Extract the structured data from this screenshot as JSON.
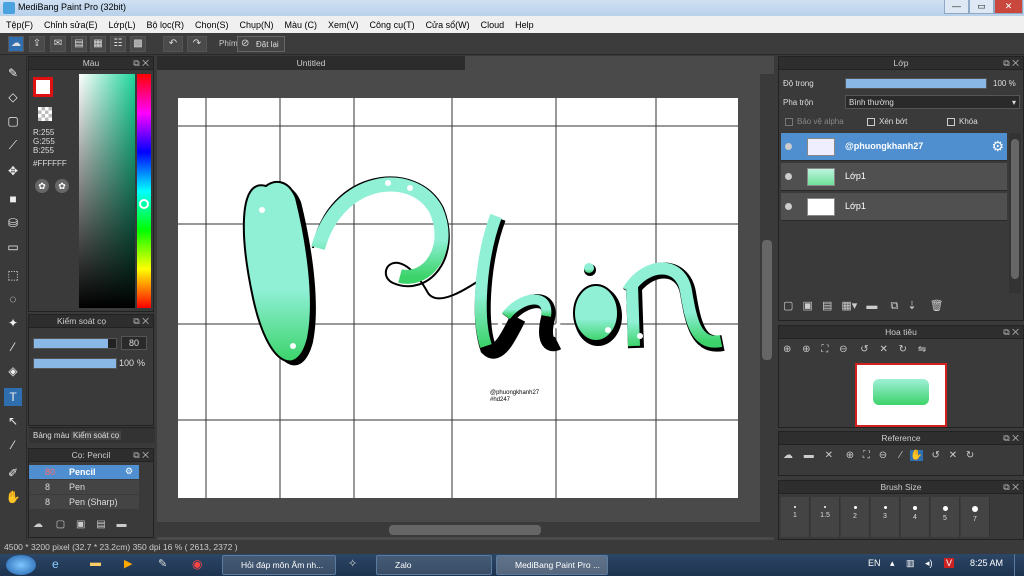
{
  "app": {
    "window_title": "MediBang Paint Pro (32bit)",
    "minimize": "—",
    "maximize": "▭",
    "close": "✕"
  },
  "menu": [
    "Tệp(F)",
    "Chỉnh sửa(E)",
    "Lớp(L)",
    "Bộ lọc(R)",
    "Chọn(S)",
    "Chụp(N)",
    "Màu (C)",
    "Xem(V)",
    "Công cụ(T)",
    "Cửa sổ(W)",
    "Cloud",
    "Help"
  ],
  "toolbar": {
    "phim_label": "Phím",
    "reset_label": "Đặt lại"
  },
  "color_panel": {
    "title": "Màu",
    "r": "R:255",
    "g": "G:255",
    "b": "B:255",
    "hex": "#FFFFFF",
    "primary_color": "#e01010"
  },
  "brush_control": {
    "title": "Kiểm soát cọ",
    "size_value": "80",
    "opacity_value": "100",
    "opacity_unit": "%",
    "size_fraction": 0.9,
    "opacity_fraction": 1.0
  },
  "left_tabs": [
    "Bảng màu",
    "Kiểm soát cọ"
  ],
  "brush_list": {
    "title": "Cọ: Pencil",
    "items": [
      {
        "size": "80",
        "name": "Pencil"
      },
      {
        "size": "8",
        "name": "Pen"
      },
      {
        "size": "8",
        "name": "Pen (Sharp)"
      }
    ]
  },
  "document": {
    "tab_title": "Untitled"
  },
  "canvas": {
    "watermark_line1": "@phuongkhanh27",
    "watermark_line2": "#hd247",
    "gradient_top": "#8ff0d6",
    "gradient_bottom": "#3cd36a"
  },
  "layers": {
    "title": "Lớp",
    "opacity_label": "Độ trong",
    "opacity_value": "100 %",
    "blend_label": "Pha trộn",
    "blend_value": "Bình thường",
    "alpha_label": "Bảo vệ alpha",
    "clip_label": "Xén bớt",
    "lock_label": "Khóa",
    "items": [
      {
        "name": "@phuongkhanh27",
        "selected": true
      },
      {
        "name": "Lớp1",
        "selected": false
      },
      {
        "name": "Lớp1",
        "selected": false
      }
    ]
  },
  "navigator": {
    "title": "Hoa tiêu"
  },
  "reference": {
    "title": "Reference"
  },
  "brush_size": {
    "title": "Brush Size",
    "sizes": [
      "1",
      "1.5",
      "2",
      "3",
      "4",
      "5",
      "7"
    ]
  },
  "status": {
    "dimensions": "4500 * 3200 pixel",
    "physical": "(32.7 * 23.2cm)",
    "dpi": "350 dpi",
    "zoom": "16 %",
    "cursor": "( 2613, 2372 )"
  },
  "taskbar": {
    "tasks": [
      "Hỏi đáp môn Âm nh...",
      "Zalo",
      "MediBang Paint Pro ..."
    ],
    "lang": "EN",
    "time": "8:25 AM"
  }
}
